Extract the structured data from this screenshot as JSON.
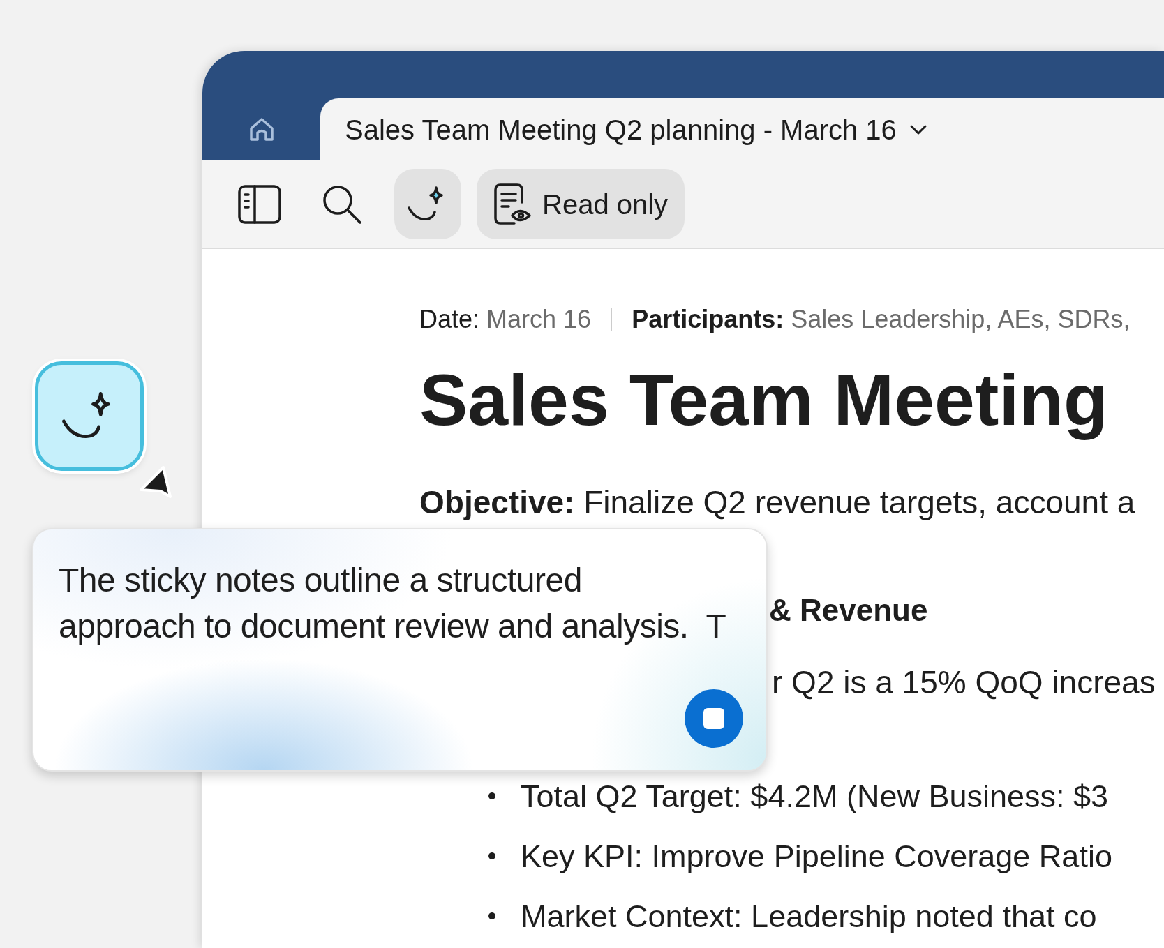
{
  "tab_bar": {
    "tabs": [
      {
        "kind": "home",
        "selected": false
      },
      {
        "kind": "document",
        "title": "Sales Team Meeting Q2 planning - March 16",
        "selected": true
      }
    ]
  },
  "toolbar": {
    "buttons": [
      {
        "kind": "sidebar",
        "selected": false
      },
      {
        "kind": "search",
        "selected": false
      },
      {
        "kind": "assistant",
        "selected": true
      },
      {
        "kind": "mode",
        "label": "Read only",
        "selected": true
      }
    ]
  },
  "document": {
    "date_label": "Date:",
    "date": "March 16",
    "participants_label": "Participants:",
    "participants": "Sales Leadership, AEs, SDRs,",
    "title": "Sales Team Meeting",
    "objective": "**Objective:** Finalize Q2 revenue targets, account a",
    "section_heading": "& Revenue",
    "paragraph": "r Q2 is a 15% QoQ increas",
    "bullets": [
      "Total Q2 Target: $4.2M (New Business: $3",
      "Key KPI: Improve Pipeline Coverage Ratio",
      "Market Context: Leadership noted that co"
    ]
  },
  "assistant_popup": {
    "text": "The sticky notes outline a structured\napproach to document review and analysis.  T",
    "generating": true
  }
}
